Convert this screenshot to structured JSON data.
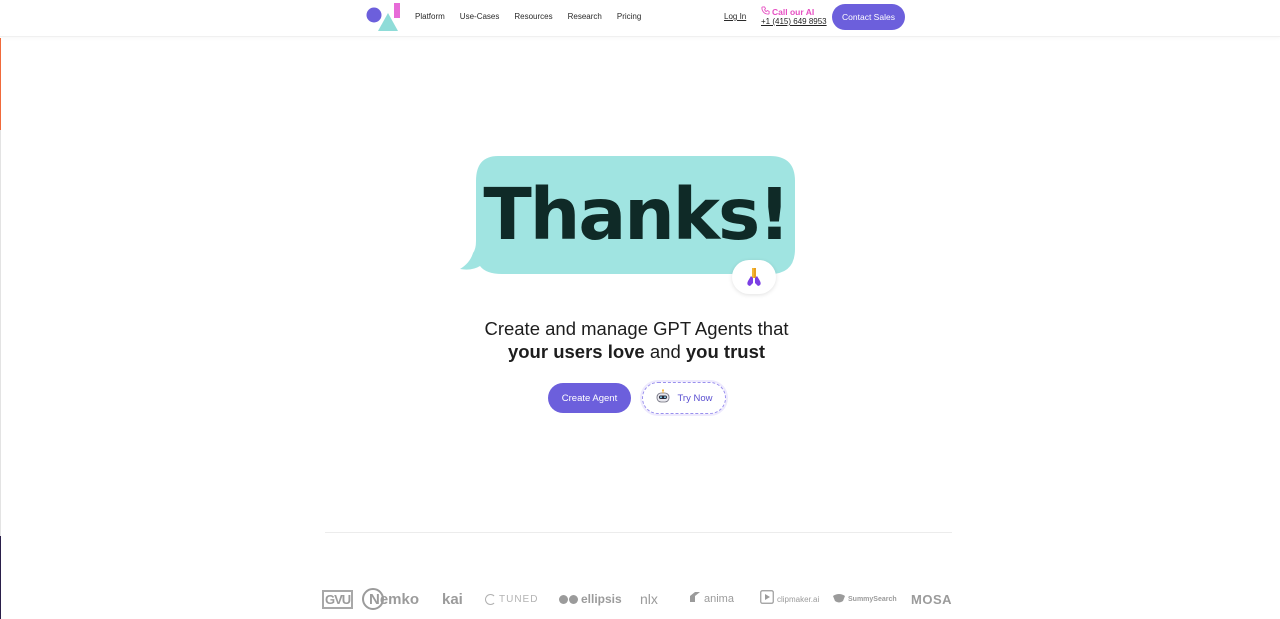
{
  "header": {
    "nav": [
      "Platform",
      "Use-Cases",
      "Resources",
      "Research",
      "Pricing"
    ],
    "login_label": "Log In",
    "call_label": "Call our AI",
    "call_phone": "+1 (415) 649 8953",
    "contact_label": "Contact Sales"
  },
  "hero": {
    "bubble_text": "Thanks!",
    "headline_line1": "Create and manage GPT Agents that",
    "headline_bold1": "your users love",
    "headline_mid": " and ",
    "headline_bold2": "you trust",
    "create_label": "Create Agent",
    "try_label": "Try Now"
  },
  "logos": [
    "GVU",
    "Nemko",
    "kai",
    "TUNED",
    "ellipsis",
    "nlx",
    "anima",
    "clipmaker.ai",
    "SummySearch",
    "MOSA"
  ],
  "colors": {
    "accent": "#6c5fdc",
    "bubble": "#a0e4e1",
    "call_pink": "#e64fc2",
    "logo_gray": "#9b9b9b"
  },
  "icons": {
    "logo": "brand-shapes-logo",
    "call": "phone-icon",
    "reaction": "praying-hands-emoji",
    "try": "robot-icon"
  }
}
